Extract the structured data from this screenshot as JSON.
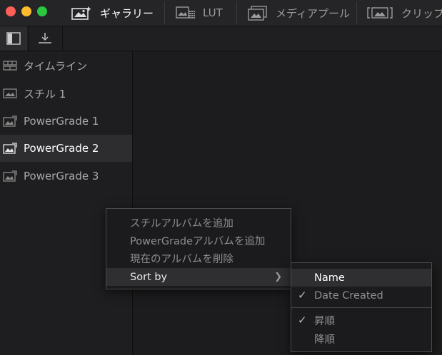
{
  "topbar": {
    "tabs": [
      {
        "label": "ギャラリー",
        "icon": "gallery-icon"
      },
      {
        "label": "LUT",
        "icon": "lut-grid-icon"
      },
      {
        "label": "メディアプール",
        "icon": "media-pool-icon"
      },
      {
        "label": "クリップ",
        "icon": "clips-icon"
      }
    ],
    "active_tab": "ギャラリー"
  },
  "toolbar": {
    "buttons": [
      {
        "icon": "sidebar-toggle-icon"
      },
      {
        "icon": "import-download-icon"
      }
    ]
  },
  "sidebar": {
    "items": [
      {
        "label": "タイムライン",
        "icon": "timeline-icon"
      },
      {
        "label": "スチル 1",
        "icon": "still-image-icon"
      },
      {
        "label": "PowerGrade 1",
        "icon": "powergrade-icon"
      },
      {
        "label": "PowerGrade 2",
        "icon": "powergrade-icon"
      },
      {
        "label": "PowerGrade 3",
        "icon": "powergrade-icon"
      }
    ],
    "selected": "PowerGrade 2"
  },
  "context_menu": {
    "items": [
      {
        "label": "スチルアルバムを追加"
      },
      {
        "label": "PowerGradeアルバムを追加"
      },
      {
        "label": "現在のアルバムを削除"
      },
      {
        "label": "Sort by",
        "submenu_arrow": "chevron-right-icon"
      }
    ]
  },
  "sort_submenu": {
    "items": [
      {
        "label": "Name",
        "checked": false,
        "highlighted": true
      },
      {
        "label": "Date Created",
        "checked": true
      },
      {
        "label": "昇順",
        "checked": true
      },
      {
        "label": "降順",
        "checked": false
      }
    ],
    "check_glyph": "✓"
  },
  "colors": {
    "background": "#1c1c1e",
    "selected_row": "#2d2d2f",
    "close": "#fe5f57",
    "minimize": "#febc2e",
    "zoom": "#28c840"
  }
}
